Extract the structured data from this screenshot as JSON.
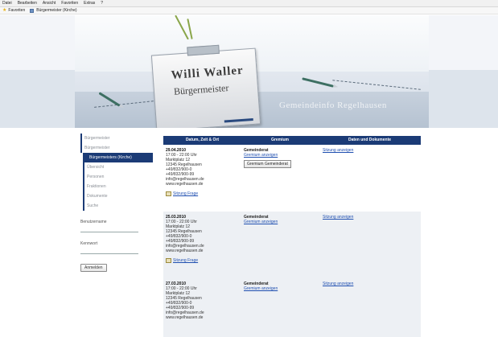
{
  "browser": {
    "menu": [
      "Datei",
      "Bearbeiten",
      "Ansicht",
      "Favoriten",
      "Extras",
      "?"
    ],
    "favorites_label": "Favoriten",
    "tab_title": "Bürgermeister (Kirche)"
  },
  "banner": {
    "name": "Willi Waller",
    "title": "Bürgermeister",
    "tagline": "Gemeindeinfo Regelhausen"
  },
  "sidebar": {
    "items": [
      "Bürgermeister",
      "Bürgermeister",
      "Bürgermeisters (Kirche)",
      "Übersicht",
      "Personen",
      "Fraktionen",
      "Dokumente",
      "Suche"
    ],
    "username_label": "Benutzername",
    "password_label": "Kennwort",
    "login_button": "Anmelden"
  },
  "table": {
    "headers": [
      "Datum, Zeit & Ort",
      "Gremium",
      "Daten und Dokumente"
    ],
    "rows": [
      {
        "date": "29.04.2010",
        "time": "17:00 - 22:00 Uhr",
        "address1": "Marktplatz 12",
        "address2": "12345 Regelhausen",
        "phone": "+49/832/900-0",
        "fax": "+49/832/900-99",
        "email": "info@regelhausen.de",
        "web": "www.regelhausen.de",
        "print": "Sitzung Frage",
        "type": "Gemeinderat",
        "details_link": "Gremium anzeigen",
        "button": "Gremium Gemeinderat",
        "docs_link": "Sitzung anzeigen"
      },
      {
        "date": "25.03.2010",
        "time": "17:00 - 22:00 Uhr",
        "address1": "Marktplatz 12",
        "address2": "12345 Regelhausen",
        "phone": "+49/832/900-0",
        "fax": "+49/832/900-99",
        "email": "info@regelhausen.de",
        "web": "www.regelhausen.de",
        "print": "Sitzung Frage",
        "type": "Gemeinderat",
        "details_link": "Gremium anzeigen",
        "docs_link": "Sitzung anzeigen"
      },
      {
        "date": "27.03.2010",
        "time": "17:00 - 22:00 Uhr",
        "address1": "Marktplatz 12",
        "address2": "12345 Regelhausen",
        "phone": "+49/832/900-0",
        "fax": "+49/832/900-99",
        "email": "info@regelhausen.de",
        "web": "www.regelhausen.de",
        "type": "Gemeinderat",
        "details_link": "Gremium anzeigen",
        "docs_link": "Sitzung anzeigen"
      }
    ]
  },
  "colors": {
    "nav_blue": "#1b3b76",
    "link": "#1f4fb0"
  }
}
